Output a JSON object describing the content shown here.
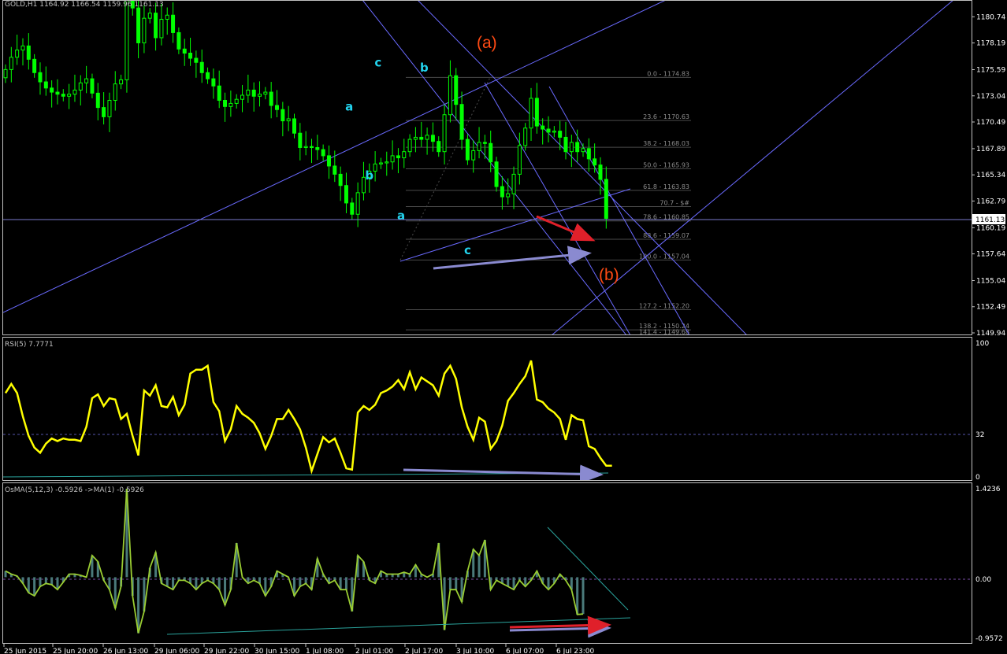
{
  "header": {
    "title": "GOLD,H1  1164.92 1166.54 1159.96 1161.13"
  },
  "price_axis": {
    "ticks": [
      "1180.74",
      "1178.19",
      "1175.59",
      "1173.04",
      "1170.49",
      "1167.89",
      "1165.34",
      "1162.79",
      "1160.19",
      "1157.64",
      "1155.04",
      "1152.49",
      "1149.94"
    ],
    "current": "1161.13"
  },
  "fib": [
    {
      "label": "0.0 - 1174.83",
      "price": 1174.83
    },
    {
      "label": "23.6 - 1170.63",
      "price": 1170.63
    },
    {
      "label": "38.2 - 1168.03",
      "price": 1168.03
    },
    {
      "label": "50.0 - 1165.93",
      "price": 1165.93
    },
    {
      "label": "61.8 - 1163.83",
      "price": 1163.83
    },
    {
      "label": "70.7 - $#",
      "price": 1162.25
    },
    {
      "label": "78.6 - 1160.85",
      "price": 1160.85
    },
    {
      "label": "88.6 - 1159.07",
      "price": 1159.07
    },
    {
      "label": "100.0 - 1157.04",
      "price": 1157.04
    },
    {
      "label": "127.2 - 1152.20",
      "price": 1152.2
    },
    {
      "label": "138.2 - 1150.24",
      "price": 1150.24
    },
    {
      "label": "141.4 - 1149.68",
      "price": 1149.68
    }
  ],
  "waves": {
    "big_a": "(a)",
    "big_b": "(b)",
    "small": [
      {
        "text": "c",
        "price": 1175.9,
        "bar": 64.5
      },
      {
        "text": "b",
        "price": 1175.4,
        "bar": 72.5
      },
      {
        "text": "a",
        "price": 1171.6,
        "bar": 59.5
      },
      {
        "text": "b",
        "price": 1164.9,
        "bar": 63.0
      },
      {
        "text": "a",
        "price": 1161.0,
        "bar": 68.5
      },
      {
        "text": "c",
        "price": 1157.6,
        "bar": 80.0
      }
    ]
  },
  "rsi": {
    "title": "RSI(5) 7.7771",
    "ticks": [
      "100",
      "32",
      "0"
    ]
  },
  "osma": {
    "title": "OsMA(5,12,3) -0.5926   ->MA(1) -0.5926",
    "ticks": [
      "1.4236",
      "0.00",
      "-0.9572"
    ]
  },
  "time_axis": [
    "25 Jun 2015",
    "25 Jun 20:00",
    "26 Jun 13:00",
    "29 Jun 06:00",
    "29 Jun 22:00",
    "30 Jun 15:00",
    "1 Jul 08:00",
    "2 Jul 01:00",
    "2 Jul 17:00",
    "3 Jul 10:00",
    "6 Jul 07:00",
    "6 Jul 23:00"
  ],
  "colors": {
    "bull": "#00ff00",
    "bear": "#00ff00",
    "bg": "#000000",
    "rsi": "#ffff00",
    "osma_line": "#9acd32",
    "osma_hist": "#4a7a7a",
    "channel": "#6a6aff",
    "arrow_red": "#e0202a",
    "arrow_purple": "#8a8ad0",
    "wave_small": "#22d3ee",
    "wave_big": "#ff4a13"
  },
  "chart_data": [
    {
      "type": "candlestick",
      "series_name": "GOLD,H1",
      "ylim": [
        1149.94,
        1182.3
      ],
      "x_labels": [
        "25 Jun 2015",
        "25 Jun 20:00",
        "26 Jun 13:00",
        "29 Jun 06:00",
        "29 Jun 22:00",
        "30 Jun 15:00",
        "1 Jul 08:00",
        "2 Jul 01:00",
        "2 Jul 17:00",
        "3 Jul 10:00",
        "6 Jul 07:00",
        "6 Jul 23:00"
      ],
      "close": [
        1175.6,
        1176.8,
        1177.5,
        1177.9,
        1176.6,
        1175.3,
        1174.4,
        1173.8,
        1173.4,
        1173.2,
        1173.0,
        1173.2,
        1173.6,
        1174.3,
        1174.7,
        1173.3,
        1171.9,
        1171.0,
        1172.6,
        1174.2,
        1174.6,
        1182.5,
        1181.6,
        1178.2,
        1180.6,
        1181.1,
        1178.7,
        1180.5,
        1180.9,
        1179.2,
        1177.6,
        1177.2,
        1176.7,
        1176.3,
        1175.3,
        1174.7,
        1174.0,
        1172.6,
        1172.0,
        1172.3,
        1172.7,
        1173.1,
        1173.6,
        1173.0,
        1173.2,
        1173.4,
        1172.1,
        1171.7,
        1170.6,
        1170.8,
        1169.4,
        1168.0,
        1168.1,
        1168.0,
        1167.8,
        1167.2,
        1166.2,
        1165.4,
        1164.3,
        1162.6,
        1161.5,
        1163.6,
        1165.1,
        1165.7,
        1166.4,
        1166.5,
        1166.6,
        1167.2,
        1167.0,
        1167.6,
        1168.8,
        1169.0,
        1168.8,
        1169.2,
        1168.6,
        1167.6,
        1171.2,
        1175.0,
        1172.2,
        1168.8,
        1166.8,
        1167.7,
        1168.5,
        1168.4,
        1166.6,
        1164.2,
        1163.2,
        1163.5,
        1165.4,
        1168.2,
        1169.9,
        1172.8,
        1170.1,
        1169.8,
        1169.5,
        1169.6,
        1169.0,
        1167.6,
        1168.5,
        1167.6,
        1167.9,
        1166.9,
        1166.3,
        1164.9,
        1161.1
      ],
      "overlays": [
        "rising channel",
        "descending channel",
        "fibonacci retracement 1174.83 → 1157.04"
      ]
    },
    {
      "type": "line",
      "series_name": "RSI(5)",
      "ylim": [
        0,
        100
      ],
      "level": 32,
      "values": [
        64,
        71,
        64,
        46,
        31,
        22,
        18,
        25,
        29,
        27,
        29,
        28,
        28,
        27,
        38,
        60,
        63,
        54,
        60,
        59,
        44,
        48,
        31,
        16,
        66,
        62,
        70,
        54,
        53,
        61,
        47,
        55,
        79,
        82,
        82,
        85,
        57,
        50,
        27,
        36,
        54,
        48,
        45,
        41,
        33,
        21,
        31,
        44,
        44,
        51,
        44,
        36,
        22,
        4,
        17,
        30,
        26,
        29,
        18,
        6,
        5,
        49,
        54,
        51,
        55,
        64,
        66,
        69,
        74,
        67,
        80,
        67,
        76,
        73,
        70,
        62,
        79,
        85,
        75,
        53,
        38,
        28,
        45,
        42,
        21,
        27,
        39,
        58,
        64,
        71,
        77,
        89,
        59,
        57,
        52,
        49,
        44,
        28,
        47,
        44,
        43,
        23,
        21,
        14,
        8,
        8
      ]
    },
    {
      "type": "bar+line",
      "series_name": "OsMA(5,12,3)",
      "ylim": [
        -0.9572,
        1.4236
      ],
      "values": [
        0.1,
        0.05,
        0.02,
        -0.1,
        -0.25,
        -0.3,
        -0.15,
        -0.1,
        -0.12,
        -0.2,
        -0.08,
        0.05,
        0.05,
        0.03,
        0.0,
        0.35,
        0.25,
        -0.05,
        -0.2,
        -0.5,
        -0.15,
        1.4236,
        -0.3,
        -0.9,
        -0.55,
        0.15,
        0.4,
        -0.1,
        -0.15,
        -0.2,
        -0.05,
        -0.05,
        -0.1,
        -0.2,
        -0.1,
        -0.05,
        -0.1,
        -0.2,
        -0.45,
        -0.2,
        0.55,
        0.0,
        -0.1,
        -0.05,
        -0.1,
        -0.3,
        -0.15,
        0.1,
        0.05,
        0.0,
        -0.3,
        -0.15,
        -0.1,
        -0.2,
        0.3,
        0.05,
        -0.1,
        -0.05,
        -0.2,
        -0.2,
        -0.55,
        0.35,
        0.25,
        -0.05,
        -0.1,
        0.1,
        0.05,
        0.05,
        0.05,
        0.08,
        0.05,
        0.2,
        0.05,
        0.0,
        0.05,
        0.55,
        -0.85,
        -0.2,
        -0.2,
        -0.4,
        0.1,
        0.45,
        0.35,
        0.6,
        -0.2,
        -0.05,
        -0.1,
        -0.15,
        -0.2,
        -0.05,
        -0.15,
        -0.05,
        0.1,
        -0.1,
        -0.2,
        -0.1,
        0.05,
        -0.05,
        -0.2,
        -0.6,
        -0.5926
      ]
    }
  ]
}
